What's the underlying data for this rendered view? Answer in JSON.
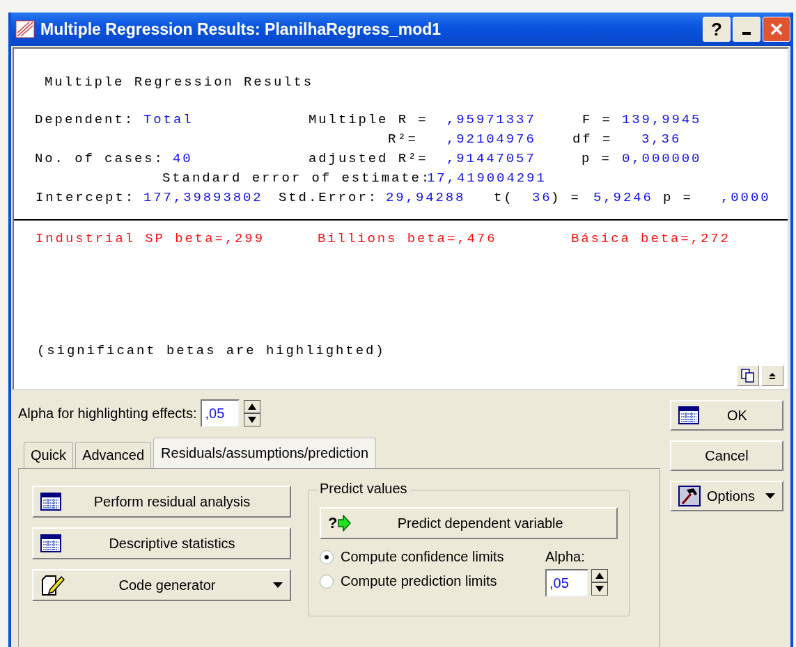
{
  "window": {
    "title": "Multiple Regression Results: PlanilhaRegress_mod1",
    "help": "?"
  },
  "results": {
    "lines": [
      [
        {
          "text": "Multiple Regression Results",
          "kind": "label"
        }
      ],
      [
        {
          "text": "Dependent:",
          "kind": "label"
        },
        {
          "text": "Total",
          "kind": "value"
        },
        {
          "text": "Multiple R =",
          "kind": "label"
        },
        {
          "text": ",95971337",
          "kind": "value"
        },
        {
          "text": "F =",
          "kind": "label"
        },
        {
          "text": "139,9945",
          "kind": "value"
        }
      ],
      [
        {
          "text": "R²=",
          "kind": "label"
        },
        {
          "text": ",92104976",
          "kind": "value"
        },
        {
          "text": "df =",
          "kind": "label"
        },
        {
          "text": "3,36",
          "kind": "value"
        }
      ],
      [
        {
          "text": "No. of cases:",
          "kind": "label"
        },
        {
          "text": "40",
          "kind": "value"
        },
        {
          "text": "adjusted R²=",
          "kind": "label"
        },
        {
          "text": ",91447057",
          "kind": "value"
        },
        {
          "text": "p =",
          "kind": "label"
        },
        {
          "text": "0,000000",
          "kind": "value"
        }
      ],
      [
        {
          "text": "Standard error of estimate:",
          "kind": "label"
        },
        {
          "text": "17,419004291",
          "kind": "value"
        }
      ],
      [
        {
          "text": "Intercept:",
          "kind": "label"
        },
        {
          "text": "177,39893802",
          "kind": "value"
        },
        {
          "text": "Std.Error:",
          "kind": "label"
        },
        {
          "text": "29,94288",
          "kind": "value"
        },
        {
          "text": "t(",
          "kind": "label"
        },
        {
          "text": "36",
          "kind": "value"
        },
        {
          "text": ") =",
          "kind": "label"
        },
        {
          "text": "5,9246",
          "kind": "value"
        },
        {
          "text": "p =",
          "kind": "label"
        },
        {
          "text": ",0000",
          "kind": "value"
        }
      ]
    ],
    "betas": [
      {
        "text": "Industrial SP beta=,299",
        "highlighted": true
      },
      {
        "text": "Billions beta=,476",
        "highlighted": true
      },
      {
        "text": "Básica beta=,272",
        "highlighted": true
      }
    ],
    "note": "(significant betas are highlighted)"
  },
  "alpha": {
    "label": "Alpha for highlighting effects:",
    "value": ",05"
  },
  "tabs": [
    {
      "label": "Quick",
      "selected": false
    },
    {
      "label": "Advanced",
      "selected": false
    },
    {
      "label": "Residuals/assumptions/prediction",
      "selected": true
    }
  ],
  "left_buttons": [
    {
      "label": "Perform residual analysis",
      "kind": "table",
      "dropdown": false
    },
    {
      "label": "Descriptive statistics",
      "kind": "table",
      "dropdown": false
    },
    {
      "label": "Code generator",
      "kind": "edit",
      "dropdown": true
    }
  ],
  "predict": {
    "title": "Predict values",
    "button": "Predict dependent variable",
    "icon_text": "?",
    "options": [
      {
        "label": "Compute confidence limits",
        "selected": true
      },
      {
        "label": "Compute prediction limits",
        "selected": false
      }
    ],
    "alpha_label": "Alpha:",
    "alpha_value": ",05"
  },
  "side_buttons": [
    {
      "label": "OK",
      "kind": "table",
      "dropdown": false
    },
    {
      "label": "Cancel",
      "kind": "plain",
      "dropdown": false
    },
    {
      "label": "Options",
      "kind": "hammer",
      "dropdown": true
    }
  ]
}
